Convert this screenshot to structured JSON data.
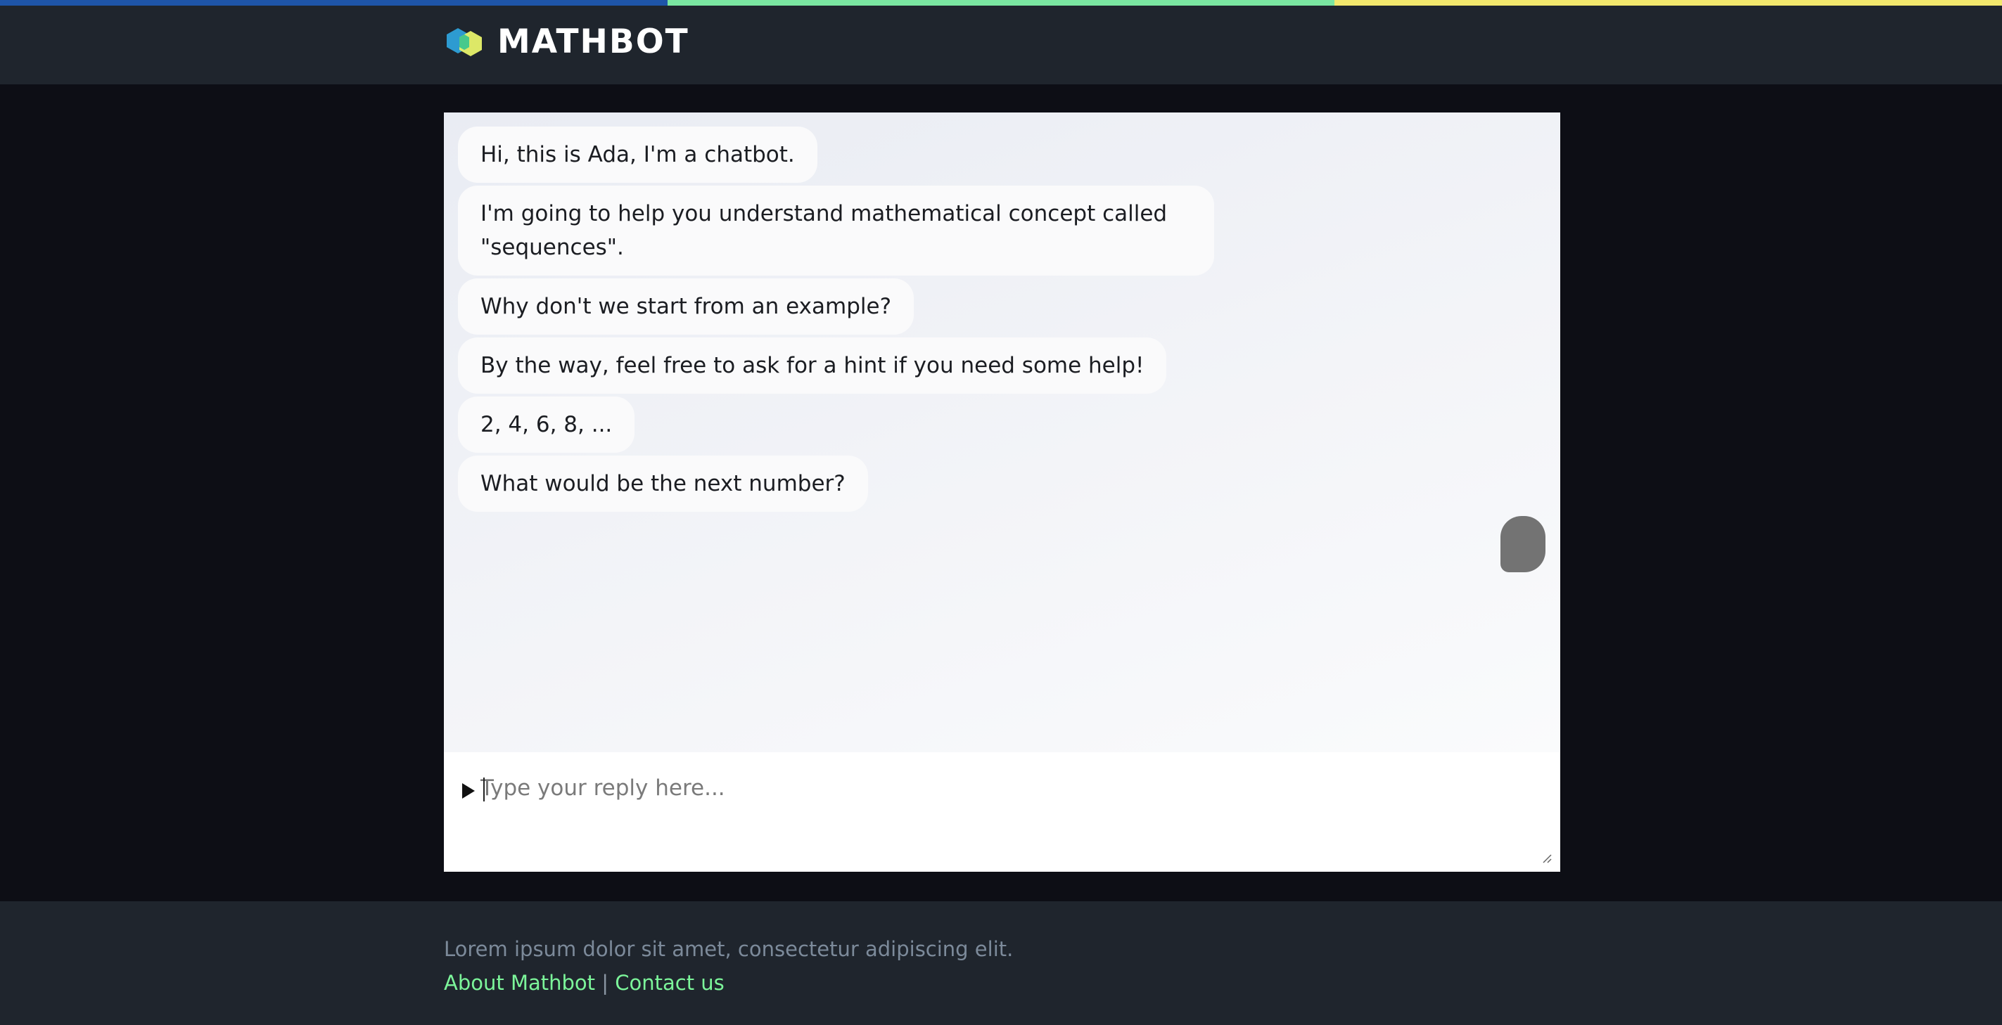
{
  "topbar": {
    "colors": [
      "#1e55a8",
      "#7ae6a1",
      "#f2e86d"
    ]
  },
  "header": {
    "brand": "MATHBOT",
    "logo_icon": "hexagon-logo-icon"
  },
  "chat": {
    "messages": [
      "Hi, this is Ada, I'm a chatbot.",
      "I'm going to help you understand mathematical concept called \"sequences\".",
      "Why don't we start from an example?",
      "By the way, feel free to ask for a hint if you need some help!",
      "2, 4, 6, 8, ...",
      "What would be the next number?"
    ],
    "typing_indicator": "typing-indicator-icon"
  },
  "reply": {
    "placeholder": "Type your reply here...",
    "send_icon": "play-arrow-icon"
  },
  "footer": {
    "text": "Lorem ipsum dolor sit amet, consectetur adipiscing elit.",
    "about_link": "About Mathbot",
    "separator": "|",
    "contact_link": "Contact us"
  },
  "colors": {
    "page_background": "#0d0e15",
    "header_background": "#1f252d",
    "link": "#7cf59a",
    "footer_text": "#7c8a9a"
  }
}
